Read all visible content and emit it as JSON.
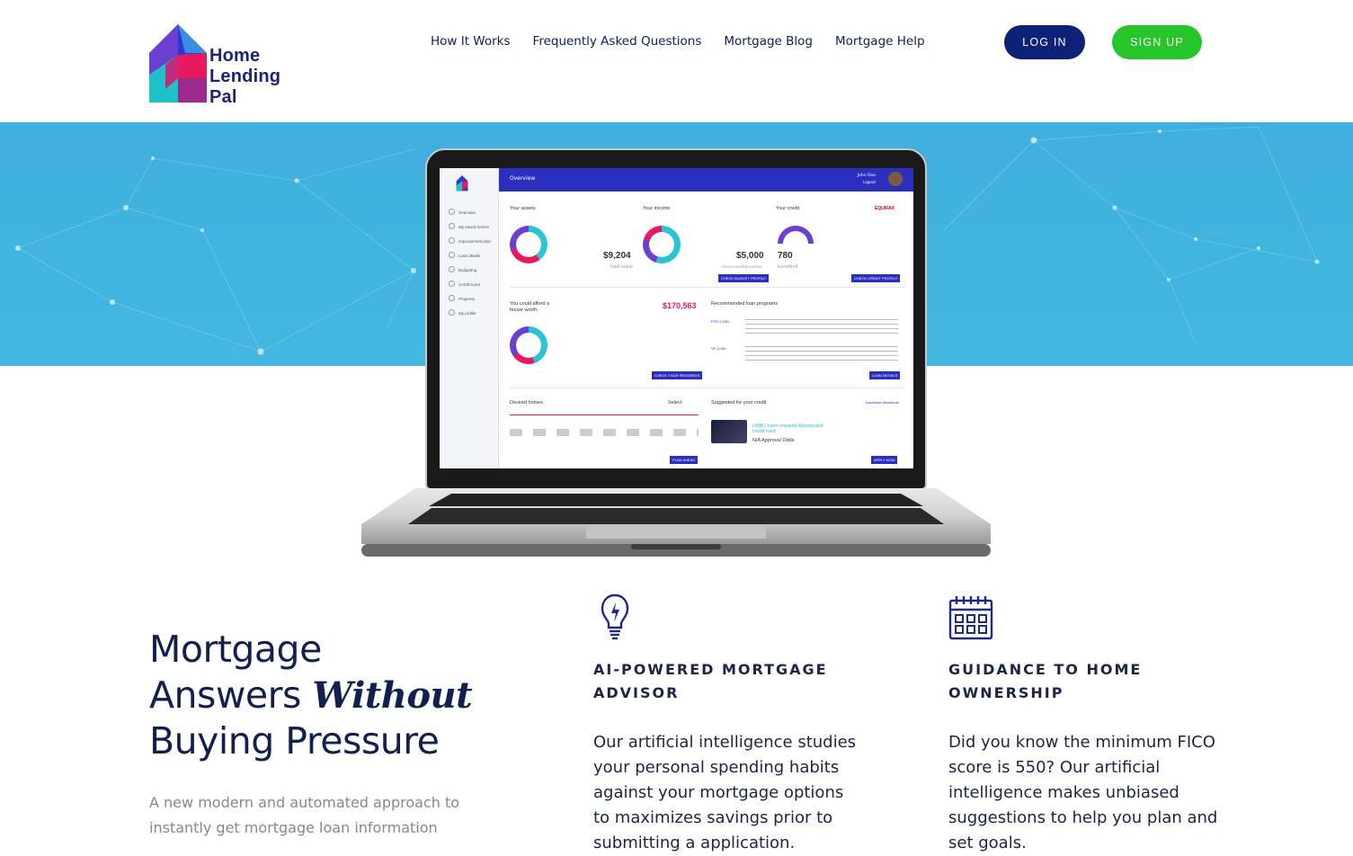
{
  "brand": {
    "line1": "Home",
    "line2": "Lending",
    "line3": "Pal"
  },
  "nav": [
    {
      "label": "How It Works"
    },
    {
      "label": "Frequently Asked Questions"
    },
    {
      "label": "Mortgage Blog"
    },
    {
      "label": "Mortgage Help"
    }
  ],
  "auth": {
    "login_label": "LOG IN",
    "signup_label": "SIGN UP"
  },
  "colors": {
    "navy": "#0d2277",
    "green": "#26c62a",
    "hero_blue": "#43b6e1",
    "text_dark": "#1c2447"
  },
  "screen": {
    "header": "Overview",
    "user": "John Doe",
    "logout": "Logout",
    "sidebar": [
      "Overview",
      "My saved homes",
      "Improvement plan",
      "Loan details",
      "Budgeting",
      "Credit score",
      "Progress",
      "My profile"
    ],
    "assets_title": "Your assets",
    "assets_value": "$9,204",
    "assets_sub": "total value",
    "income_title": "Your income",
    "income_value": "$5,000",
    "income_sub": "Gross monthly income",
    "credit_title": "Your credit",
    "credit_value": "780",
    "credit_sub": "Excellent",
    "equifax": "EQUIFAX",
    "afford_title": "You could afford a house worth:",
    "afford_value": "$170,563",
    "loan_title": "Recommended loan programs",
    "fha": "FHA Loan",
    "va": "VA Loan",
    "desired_title": "Desired homes",
    "select": "Select",
    "suggested_title": "Suggested for your credit",
    "advertiser": "Advertiser disclosure",
    "card_name": "HSBC cash rewards Mastercard credit card",
    "approval": "N/A Approval Odds",
    "btn_budget": "CHECK BUDGET PROFILE",
    "btn_credit": "CHECK CREDIT PROFILE",
    "btn_progress": "CHECK YOUR PROGRESS",
    "btn_loan": "LOAN DETAILS",
    "btn_plan": "PLAN AHEAD",
    "btn_apply": "APPLY NOW"
  },
  "hero": {
    "title_line1": "Mortgage",
    "title_line2a": "Answers ",
    "title_line2b": "Without",
    "title_line3": "Buying Pressure",
    "subtitle": "A new modern and automated approach to instantly get mortgage loan information"
  },
  "features": [
    {
      "icon": "lightbulb-icon",
      "title_line1": "AI-POWERED MORTGAGE",
      "title_line2": "ADVISOR",
      "text": "Our artificial intelligence studies your personal spending habits against your mortgage options to maximizes savings prior to submitting a application."
    },
    {
      "icon": "calendar-icon",
      "title_line1": "GUIDANCE TO HOME",
      "title_line2": "OWNERSHIP",
      "text": "Did you know the minimum FICO score is 550? Our artificial intelligence makes unbiased suggestions to help you plan and set goals."
    }
  ]
}
